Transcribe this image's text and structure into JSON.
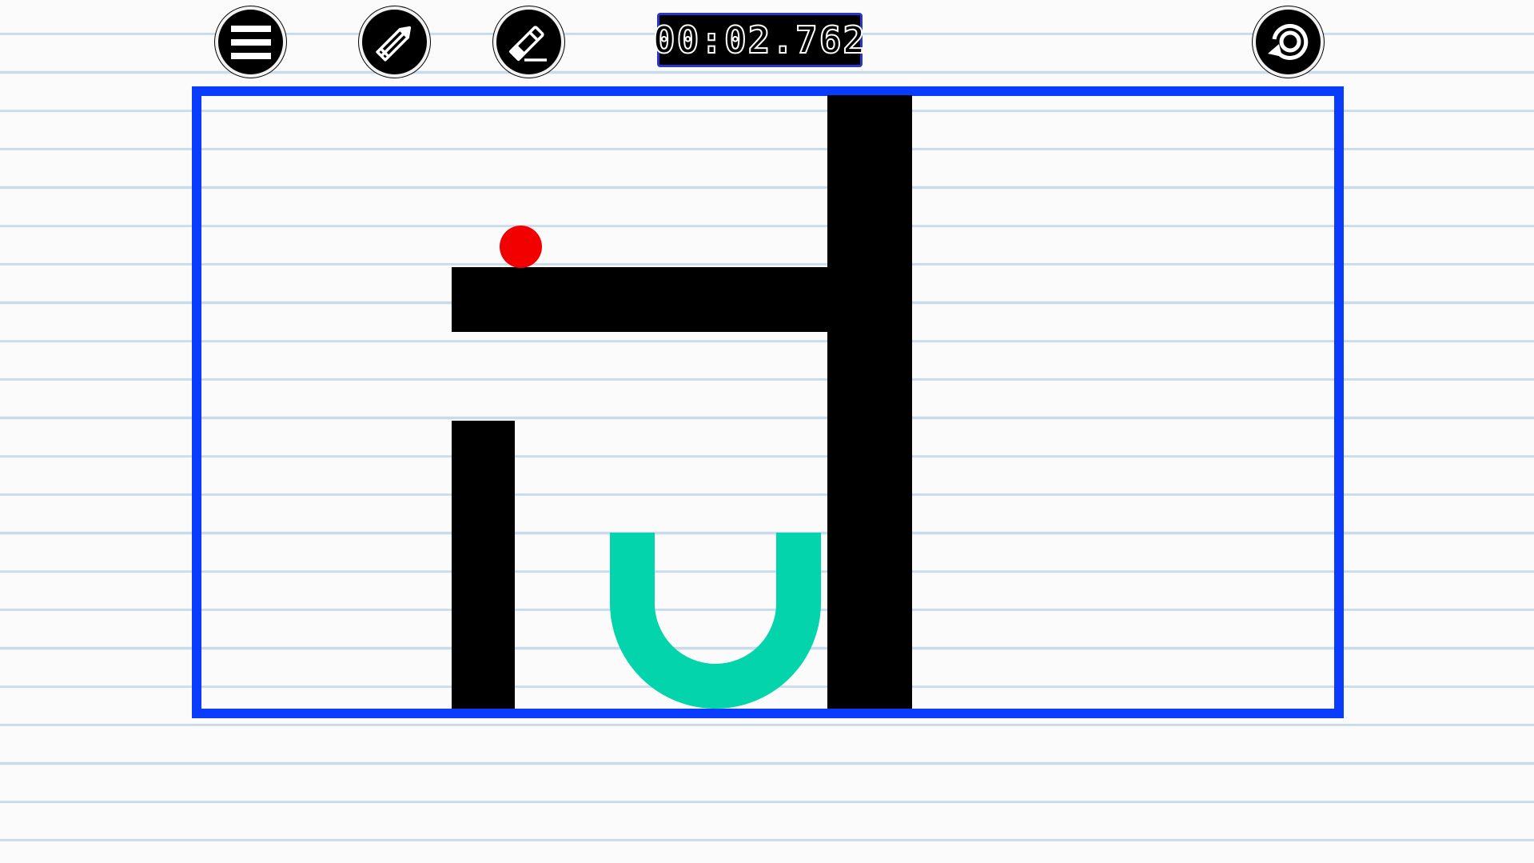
{
  "toolbar": {
    "menu_icon": "hamburger-menu-icon",
    "pencil_icon": "pencil-icon",
    "eraser_icon": "eraser-icon",
    "reset_icon": "restart-icon"
  },
  "timer": {
    "value": "00:02.762"
  },
  "colors": {
    "board_border": "#0a3cff",
    "ball": "#f20000",
    "goal": "#04d4ab",
    "wall": "#000000",
    "timer_border": "#2a35c9"
  }
}
